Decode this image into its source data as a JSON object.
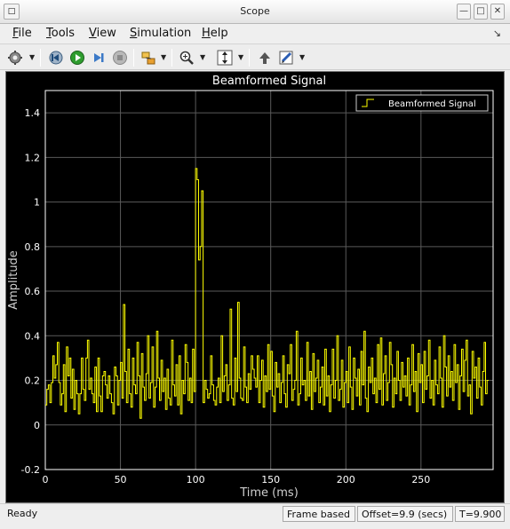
{
  "window": {
    "title": "Scope"
  },
  "menu": {
    "items": [
      {
        "label": "File",
        "mnemonic": "F",
        "rest": "ile"
      },
      {
        "label": "Tools",
        "mnemonic": "T",
        "rest": "ools"
      },
      {
        "label": "View",
        "mnemonic": "V",
        "rest": "iew"
      },
      {
        "label": "Simulation",
        "mnemonic": "S",
        "rest": "imulation"
      },
      {
        "label": "Help",
        "mnemonic": "H",
        "rest": "elp"
      }
    ]
  },
  "toolbar": {
    "icons": [
      "gear-icon",
      "step-back-icon",
      "run-icon",
      "step-forward-icon",
      "stop-icon",
      "highlight-block-icon",
      "zoom-icon",
      "scale-axes-icon",
      "restore-layout-icon",
      "style-icon"
    ]
  },
  "status": {
    "ready": "Ready",
    "frame": "Frame based",
    "offset": "Offset=9.9 (secs)",
    "time": "T=9.900"
  },
  "chart_data": {
    "type": "line",
    "title": "Beamformed Signal",
    "xlabel": "Time (ms)",
    "ylabel": "Amplitude",
    "xlim": [
      0,
      298
    ],
    "ylim": [
      -0.2,
      1.5
    ],
    "xticks": [
      0,
      50,
      100,
      150,
      200,
      250
    ],
    "yticks": [
      -0.2,
      0,
      0.2,
      0.4,
      0.6,
      0.8,
      1,
      1.2,
      1.4
    ],
    "grid": true,
    "legend_position": "top-right",
    "colors": {
      "background": "#000000",
      "line": "#ffff00",
      "axis": "#ffffff",
      "grid": "#5a5a5a"
    },
    "series": [
      {
        "name": "Beamformed Signal",
        "step": "stairs",
        "x_start": 0,
        "x_step": 1,
        "values": [
          0.09,
          0.16,
          0.18,
          0.1,
          0.19,
          0.31,
          0.21,
          0.27,
          0.37,
          0.19,
          0.09,
          0.14,
          0.27,
          0.06,
          0.35,
          0.22,
          0.3,
          0.12,
          0.25,
          0.07,
          0.2,
          0.14,
          0.05,
          0.14,
          0.3,
          0.16,
          0.11,
          0.3,
          0.38,
          0.16,
          0.21,
          0.14,
          0.1,
          0.26,
          0.06,
          0.3,
          0.13,
          0.06,
          0.22,
          0.24,
          0.18,
          0.12,
          0.22,
          0.14,
          0.1,
          0.05,
          0.26,
          0.22,
          0.09,
          0.2,
          0.28,
          0.12,
          0.54,
          0.24,
          0.1,
          0.34,
          0.14,
          0.08,
          0.3,
          0.18,
          0.14,
          0.37,
          0.22,
          0.03,
          0.32,
          0.17,
          0.11,
          0.23,
          0.4,
          0.12,
          0.19,
          0.35,
          0.08,
          0.17,
          0.42,
          0.21,
          0.11,
          0.29,
          0.15,
          0.21,
          0.07,
          0.25,
          0.12,
          0.09,
          0.38,
          0.18,
          0.13,
          0.27,
          0.09,
          0.31,
          0.05,
          0.2,
          0.14,
          0.36,
          0.28,
          0.11,
          0.21,
          0.1,
          0.34,
          0.15,
          1.15,
          1.1,
          0.74,
          0.8,
          1.05,
          0.1,
          0.2,
          0.16,
          0.12,
          0.14,
          0.31,
          0.18,
          0.11,
          0.09,
          0.17,
          0.21,
          0.1,
          0.4,
          0.15,
          0.22,
          0.27,
          0.11,
          0.18,
          0.52,
          0.12,
          0.09,
          0.3,
          0.15,
          0.55,
          0.21,
          0.12,
          0.11,
          0.35,
          0.17,
          0.1,
          0.23,
          0.16,
          0.31,
          0.25,
          0.21,
          0.17,
          0.31,
          0.1,
          0.2,
          0.29,
          0.08,
          0.22,
          0.15,
          0.36,
          0.16,
          0.33,
          0.13,
          0.06,
          0.28,
          0.17,
          0.23,
          0.1,
          0.19,
          0.31,
          0.14,
          0.08,
          0.27,
          0.23,
          0.36,
          0.11,
          0.16,
          0.2,
          0.42,
          0.09,
          0.14,
          0.3,
          0.18,
          0.2,
          0.11,
          0.37,
          0.13,
          0.24,
          0.07,
          0.32,
          0.15,
          0.21,
          0.29,
          0.1,
          0.17,
          0.26,
          0.09,
          0.34,
          0.13,
          0.22,
          0.06,
          0.18,
          0.34,
          0.12,
          0.2,
          0.4,
          0.11,
          0.16,
          0.29,
          0.08,
          0.19,
          0.24,
          0.1,
          0.35,
          0.17,
          0.07,
          0.3,
          0.21,
          0.13,
          0.25,
          0.09,
          0.33,
          0.18,
          0.42,
          0.12,
          0.06,
          0.26,
          0.19,
          0.3,
          0.14,
          0.21,
          0.1,
          0.36,
          0.16,
          0.39,
          0.09,
          0.23,
          0.31,
          0.11,
          0.19,
          0.37,
          0.27,
          0.08,
          0.21,
          0.14,
          0.33,
          0.2,
          0.11,
          0.28,
          0.17,
          0.22,
          0.13,
          0.3,
          0.09,
          0.18,
          0.36,
          0.15,
          0.24,
          0.06,
          0.32,
          0.19,
          0.27,
          0.1,
          0.33,
          0.16,
          0.22,
          0.38,
          0.12,
          0.2,
          0.09,
          0.29,
          0.18,
          0.14,
          0.35,
          0.21,
          0.08,
          0.4,
          0.26,
          0.13,
          0.31,
          0.17,
          0.24,
          0.11,
          0.36,
          0.19,
          0.27,
          0.07,
          0.22,
          0.34,
          0.15,
          0.29,
          0.38,
          0.13,
          0.18,
          0.05,
          0.33,
          0.21,
          0.26,
          0.12,
          0.3,
          0.17,
          0.09,
          0.24,
          0.37,
          0.14,
          0.2
        ]
      }
    ]
  }
}
